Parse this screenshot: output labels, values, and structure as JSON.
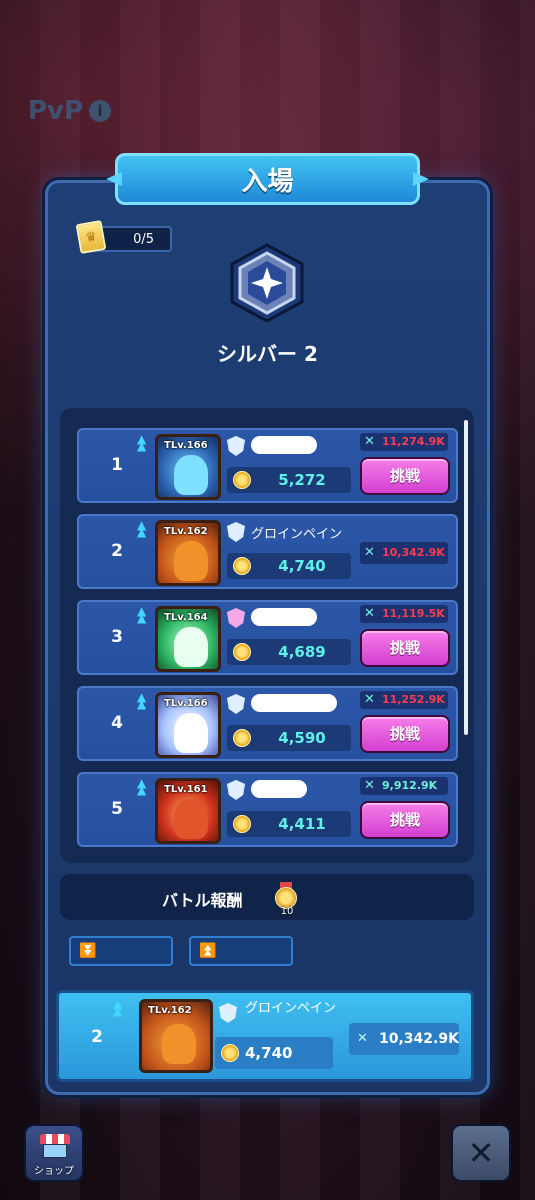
{
  "page": {
    "title": "PvP"
  },
  "panel": {
    "title": "入場",
    "ticket_count": "0/5",
    "rank_name": "シルバー 2"
  },
  "labels": {
    "challenge": "挑戦"
  },
  "opponents": [
    {
      "rank": "1",
      "level": "TLv.166",
      "name": "",
      "score": "5,272",
      "power": "11,274.9K",
      "power_color": "#ff3b4e",
      "has_challenge": true
    },
    {
      "rank": "2",
      "level": "TLv.162",
      "name": "グロインペイン",
      "score": "4,740",
      "power": "10,342.9K",
      "power_color": "#ff3b4e",
      "has_challenge": false
    },
    {
      "rank": "3",
      "level": "TLv.164",
      "name": "",
      "score": "4,689",
      "power": "11,119.5K",
      "power_color": "#ff3b4e",
      "has_challenge": true
    },
    {
      "rank": "4",
      "level": "TLv.166",
      "name": "",
      "score": "4,590",
      "power": "11,252.9K",
      "power_color": "#ff3b4e",
      "has_challenge": true
    },
    {
      "rank": "5",
      "level": "TLv.161",
      "name": "",
      "score": "4,411",
      "power": "9,912.9K",
      "power_color": "#6df2d8",
      "has_challenge": true
    }
  ],
  "reward": {
    "label": "バトル報酬",
    "count": "10"
  },
  "self": {
    "rank": "2",
    "level": "TLv.162",
    "name": "グロインペイン",
    "score": "4,740",
    "power": "10,342.9K"
  },
  "footer": {
    "shop_label": "ショップ"
  },
  "colors": {
    "panel_bg": "#1e3f75",
    "header_bg": "#42c3f2",
    "challenge_button": "#e85ce0",
    "score_text": "#5ff0e8",
    "power_stronger": "#ff3b4e",
    "power_weaker": "#6df2d8",
    "self_row_bg": "#3ec0f2"
  },
  "icons": [
    "info-icon",
    "ticket-icon",
    "silver-rank-emblem-icon",
    "rank-up-icon",
    "shield-icon",
    "medal-icon",
    "crossed-swords-icon",
    "reward-medal-icon",
    "double-chevron-down-icon",
    "double-chevron-up-icon",
    "shop-icon",
    "close-icon"
  ]
}
